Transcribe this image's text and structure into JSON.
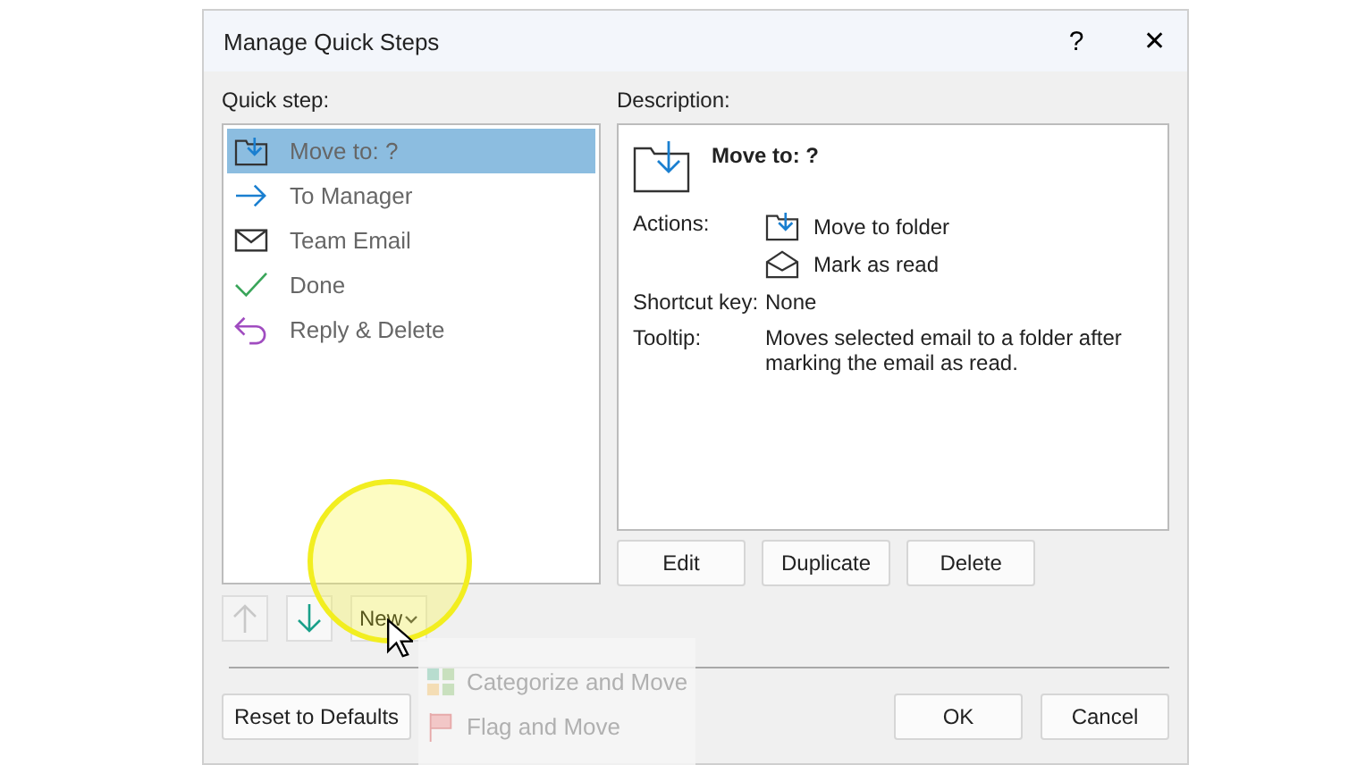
{
  "window": {
    "title": "Manage Quick Steps",
    "help": "?",
    "close": "✕"
  },
  "quick_steps": {
    "label": "Quick step:",
    "items": [
      {
        "label": "Move to: ?",
        "kind": "move",
        "selected": true
      },
      {
        "label": "To Manager",
        "kind": "forward",
        "selected": false
      },
      {
        "label": "Team Email",
        "kind": "email",
        "selected": false
      },
      {
        "label": "Done",
        "kind": "done",
        "selected": false
      },
      {
        "label": "Reply & Delete",
        "kind": "reply",
        "selected": false
      }
    ]
  },
  "description": {
    "label": "Description:",
    "title": "Move to: ?",
    "actions_label": "Actions:",
    "actions": [
      {
        "label": "Move to folder",
        "kind": "move"
      },
      {
        "label": "Mark as read",
        "kind": "read"
      }
    ],
    "shortcut_label": "Shortcut key:",
    "shortcut": "None",
    "tooltip_label": "Tooltip:",
    "tooltip": "Moves selected email to a folder after marking the email as read."
  },
  "description_buttons": [
    "Edit",
    "Duplicate",
    "Delete"
  ],
  "move_up": {
    "disabled": true
  },
  "move_down": {
    "disabled": false
  },
  "new_button": "New",
  "new_menu": [
    {
      "label": "Categorize and Move",
      "kind": "categorize"
    },
    {
      "label": "Flag and Move",
      "kind": "flag"
    }
  ],
  "footer_buttons": {
    "reset": "Reset to Defaults",
    "ok": "OK",
    "cancel": "Cancel"
  }
}
